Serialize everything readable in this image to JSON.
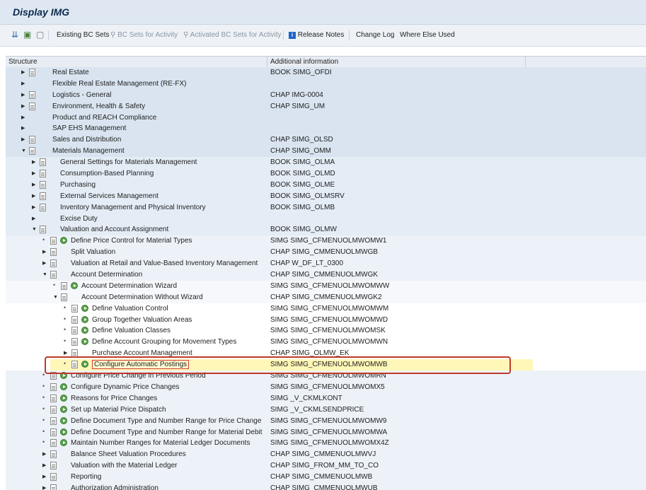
{
  "window": {
    "title": "Display IMG"
  },
  "toolbar": {
    "items": [
      {
        "label": "Existing BC Sets",
        "disabled": false
      },
      {
        "label": "BC Sets for Activity",
        "disabled": true
      },
      {
        "label": "Activated BC Sets for Activity",
        "disabled": true
      },
      {
        "label": "Release Notes",
        "disabled": false
      },
      {
        "label": "Change Log",
        "disabled": false
      },
      {
        "label": "Where Else Used",
        "disabled": false
      }
    ]
  },
  "grid": {
    "columns": [
      "Structure",
      "Additional information"
    ],
    "rows": [
      {
        "level": 0,
        "expander": "collapsed",
        "doc": true,
        "exec": false,
        "label": "Real Estate",
        "info": "BOOK SIMG_OFDI"
      },
      {
        "level": 0,
        "expander": "collapsed",
        "doc": false,
        "exec": false,
        "label": "Flexible Real Estate Management (RE-FX)",
        "info": ""
      },
      {
        "level": 0,
        "expander": "collapsed",
        "doc": true,
        "exec": false,
        "label": "Logistics - General",
        "info": "CHAP IMG-0004"
      },
      {
        "level": 0,
        "expander": "collapsed",
        "doc": true,
        "exec": false,
        "label": "Environment, Health & Safety",
        "info": "CHAP SIMG_UM"
      },
      {
        "level": 0,
        "expander": "collapsed",
        "doc": false,
        "exec": false,
        "label": "Product and REACH Compliance",
        "info": ""
      },
      {
        "level": 0,
        "expander": "collapsed",
        "doc": false,
        "exec": false,
        "label": "SAP EHS Management",
        "info": ""
      },
      {
        "level": 0,
        "expander": "collapsed",
        "doc": true,
        "exec": false,
        "label": "Sales and Distribution",
        "info": "CHAP SIMG_OLSD"
      },
      {
        "level": 0,
        "expander": "expanded",
        "doc": true,
        "exec": false,
        "label": "Materials Management",
        "info": "CHAP SIMG_OMM"
      },
      {
        "level": 1,
        "expander": "collapsed",
        "doc": true,
        "exec": false,
        "label": "General Settings for Materials Management",
        "info": "BOOK SIMG_OLMA"
      },
      {
        "level": 1,
        "expander": "collapsed",
        "doc": true,
        "exec": false,
        "label": "Consumption-Based Planning",
        "info": "BOOK SIMG_OLMD"
      },
      {
        "level": 1,
        "expander": "collapsed",
        "doc": true,
        "exec": false,
        "label": "Purchasing",
        "info": "BOOK SIMG_OLME"
      },
      {
        "level": 1,
        "expander": "collapsed",
        "doc": true,
        "exec": false,
        "label": "External Services Management",
        "info": "BOOK SIMG_OLMSRV"
      },
      {
        "level": 1,
        "expander": "collapsed",
        "doc": true,
        "exec": false,
        "label": "Inventory Management and Physical Inventory",
        "info": "BOOK SIMG_OLMB"
      },
      {
        "level": 1,
        "expander": "collapsed",
        "doc": false,
        "exec": false,
        "label": "Excise Duty",
        "info": ""
      },
      {
        "level": 1,
        "expander": "expanded",
        "doc": true,
        "exec": false,
        "label": "Valuation and Account Assignment",
        "info": "BOOK SIMG_OLMW"
      },
      {
        "level": 2,
        "expander": "leaf",
        "doc": true,
        "exec": true,
        "label": "Define Price Control for Material Types",
        "info": "SIMG SIMG_CFMENUOLMWOMW1"
      },
      {
        "level": 2,
        "expander": "collapsed",
        "doc": true,
        "exec": false,
        "label": "Split Valuation",
        "info": "CHAP SIMG_CMMENUOLMWGB"
      },
      {
        "level": 2,
        "expander": "collapsed",
        "doc": true,
        "exec": false,
        "label": "Valuation at Retail and Value-Based Inventory Management",
        "info": "CHAP W_DF_LT_0300"
      },
      {
        "level": 2,
        "expander": "expanded",
        "doc": true,
        "exec": false,
        "label": "Account Determination",
        "info": "CHAP SIMG_CMMENUOLMWGK"
      },
      {
        "level": 3,
        "expander": "leaf",
        "doc": true,
        "exec": true,
        "label": "Account Determination Wizard",
        "info": "SIMG SIMG_CFMENUOLMWOMWW"
      },
      {
        "level": 3,
        "expander": "expanded",
        "doc": true,
        "exec": false,
        "label": "Account Determination Without Wizard",
        "info": "CHAP SIMG_CMMENUOLMWGK2"
      },
      {
        "level": 4,
        "expander": "leaf",
        "doc": true,
        "exec": true,
        "label": "Define Valuation Control",
        "info": "SIMG SIMG_CFMENUOLMWOMWM"
      },
      {
        "level": 4,
        "expander": "leaf",
        "doc": true,
        "exec": true,
        "label": "Group Together Valuation Areas",
        "info": "SIMG SIMG_CFMENUOLMWOMWD"
      },
      {
        "level": 4,
        "expander": "leaf",
        "doc": true,
        "exec": true,
        "label": "Define Valuation Classes",
        "info": "SIMG SIMG_CFMENUOLMWOMSK"
      },
      {
        "level": 4,
        "expander": "leaf",
        "doc": true,
        "exec": true,
        "label": "Define Account Grouping for Movement Types",
        "info": "SIMG SIMG_CFMENUOLMWOMWN"
      },
      {
        "level": 4,
        "expander": "collapsed",
        "doc": true,
        "exec": false,
        "label": "Purchase Account Management",
        "info": "CHAP SIMG_OLMW_EK"
      },
      {
        "level": 4,
        "expander": "leaf",
        "doc": true,
        "exec": true,
        "label": "Configure Automatic Postings",
        "info": "SIMG SIMG_CFMENUOLMWOMWB",
        "selected": true
      },
      {
        "level": 2,
        "expander": "leaf",
        "doc": true,
        "exec": true,
        "label": "Configure Price Change in Previous Period",
        "info": "SIMG SIMG_CFMENUOLMWOMRN"
      },
      {
        "level": 2,
        "expander": "leaf",
        "doc": true,
        "exec": true,
        "label": "Configure Dynamic Price Changes",
        "info": "SIMG SIMG_CFMENUOLMWOMX5"
      },
      {
        "level": 2,
        "expander": "leaf",
        "doc": true,
        "exec": true,
        "label": "Reasons for Price Changes",
        "info": "SIMG _V_CKMLKONT"
      },
      {
        "level": 2,
        "expander": "leaf",
        "doc": true,
        "exec": true,
        "label": "Set up Material Price Dispatch",
        "info": "SIMG _V_CKMLSENDPRICE"
      },
      {
        "level": 2,
        "expander": "leaf",
        "doc": true,
        "exec": true,
        "label": "Define Document Type and Number Range for Price Change",
        "info": "SIMG SIMG_CFMENUOLMWOMW9"
      },
      {
        "level": 2,
        "expander": "leaf",
        "doc": true,
        "exec": true,
        "label": "Define Document Type and Number Range for Material Debit",
        "info": "SIMG SIMG_CFMENUOLMWOMWA"
      },
      {
        "level": 2,
        "expander": "leaf",
        "doc": true,
        "exec": true,
        "label": "Maintain Number Ranges for Material Ledger Documents",
        "info": "SIMG SIMG_CFMENUOLMWOMX4Z"
      },
      {
        "level": 2,
        "expander": "collapsed",
        "doc": true,
        "exec": false,
        "label": "Balance Sheet Valuation Procedures",
        "info": "CHAP SIMG_CMMENUOLMWVJ"
      },
      {
        "level": 2,
        "expander": "collapsed",
        "doc": true,
        "exec": false,
        "label": "Valuation with the Material Ledger",
        "info": "CHAP SIMG_FROM_MM_TO_CO"
      },
      {
        "level": 2,
        "expander": "collapsed",
        "doc": true,
        "exec": false,
        "label": "Reporting",
        "info": "CHAP SIMG_CMMENUOLMWB"
      },
      {
        "level": 2,
        "expander": "collapsed",
        "doc": true,
        "exec": false,
        "label": "Authorization Administration",
        "info": "CHAP SIMG_CMMENUOLMWUB"
      }
    ]
  },
  "colors": {
    "selection_border": "#c0392b",
    "selection_fill": "#fff7b8",
    "execute_icon": "#5aa24b"
  }
}
